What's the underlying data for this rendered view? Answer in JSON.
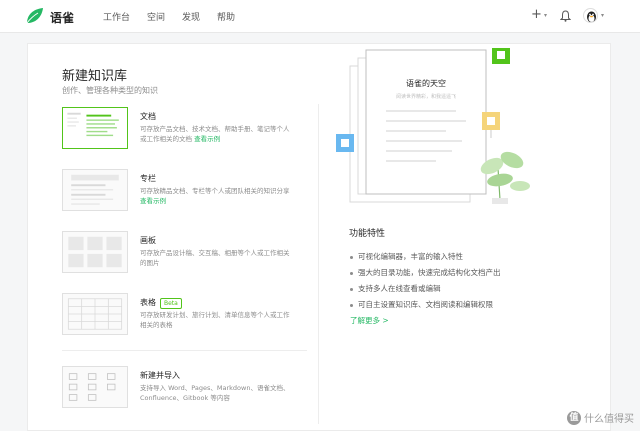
{
  "topbar": {
    "brand": "语雀",
    "nav": [
      "工作台",
      "空间",
      "发现",
      "帮助"
    ],
    "plus_icon": "+",
    "caret": "▾"
  },
  "page": {
    "title": "新建知识库",
    "subtitle": "创作、管理各种类型的知识"
  },
  "types": [
    {
      "name": "文档",
      "desc": "可存放产品文档、技术文档、帮助手册、笔记等个人或工作相关的文档",
      "link": "查看示例",
      "selected": true
    },
    {
      "name": "专栏",
      "desc": "可存放精品文档、专栏等个人或团队相关的知识分享",
      "link": "查看示例"
    },
    {
      "name": "画板",
      "desc": "可存放产品设计稿、交互稿、相册等个人或工作相关的图片"
    },
    {
      "name": "表格",
      "badge": "Beta",
      "desc": "可存放研发计划、旅行计划、清单信息等个人或工作相关的表格"
    },
    {
      "name": "新建并导入",
      "desc": "支持导入 Word、Pages、Markdown、语雀文档、Confluence、Gitbook 等内容"
    }
  ],
  "illustration": {
    "doc_title": "语雀的天空",
    "doc_subtitle": "阅读世界精彩，和我遥遥飞"
  },
  "features": {
    "title": "功能特性",
    "items": [
      "可视化编辑器，丰富的输入特性",
      "强大的目录功能，快速完成结构化文档产出",
      "支持多人在线查看或编辑",
      "可自主设置知识库、文档阅读和编辑权限"
    ],
    "learn_more": "了解更多 >"
  },
  "watermark": {
    "badge": "值",
    "text": "什么值得买"
  },
  "colors": {
    "accent": "#25b864",
    "green": "#52c41a",
    "bg": "#f5f6f7"
  }
}
